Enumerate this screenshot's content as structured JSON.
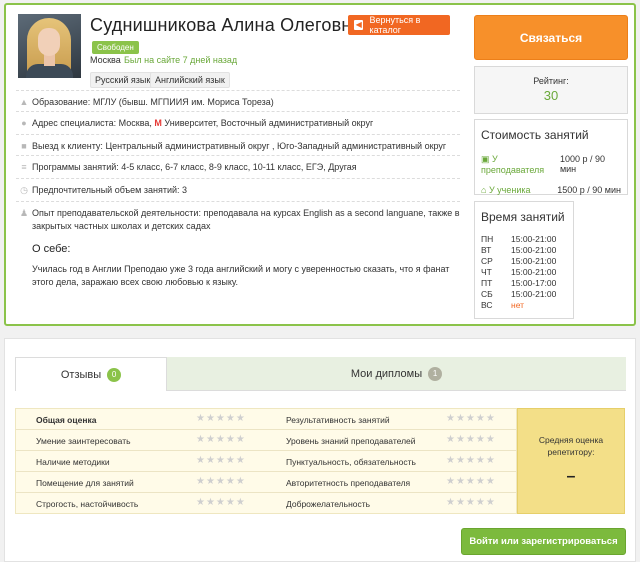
{
  "profile": {
    "name": "Суднишникова Алина Олеговна",
    "back_label": "Вернуться в каталог",
    "status": "Свободен",
    "city": "Москва",
    "last_seen": "Был на сайте 7 дней назад",
    "languages": [
      "Русский язык",
      "Английский язык"
    ],
    "info": [
      {
        "icon": "graduation-cap-icon",
        "label": "Образование:",
        "value": "МГЛУ (бывш. МГПИИЯ им. Мориса Тореза)"
      },
      {
        "icon": "location-icon",
        "label": "Адрес специалиста:",
        "value_before": "Москва,",
        "metro": "M",
        "value_after": "Университет, Восточный административный округ"
      },
      {
        "icon": "car-icon",
        "label": "Выезд к клиенту:",
        "value": "Центральный административный округ , Юго-Западный административный округ"
      },
      {
        "icon": "list-icon",
        "label": "Программы занятий:",
        "value": "4-5 класс, 6-7 класс, 8-9 класс, 10-11 класс, ЕГЭ, Другая"
      },
      {
        "icon": "clock-icon",
        "label": "Предпочтительный объем занятий:",
        "value": "3"
      },
      {
        "icon": "person-icon",
        "label": "Опыт преподавательской деятельности:",
        "value": "преподавала на курсах English as a second languane, также в закрытых частных школах и детских садах"
      }
    ],
    "about_title": "О себе:",
    "about_text": "Училась год в Англии Преподаю уже 3 года английский и могу с уверенностью сказать, что я фанат этого дела, заражаю всех свою любовью к языку."
  },
  "sidebar": {
    "contact_label": "Связаться",
    "rating_label": "Рейтинг:",
    "rating_value": "30",
    "cost_title": "Стоимость занятий",
    "costs": [
      {
        "where": "У преподавателя",
        "price": "1000 р / 90 мин"
      },
      {
        "where": "У ученика",
        "price": "1500 р / 90 мин"
      }
    ],
    "schedule_title": "Время занятий",
    "schedule": [
      {
        "day": "ПН",
        "time": "15:00-21:00"
      },
      {
        "day": "ВТ",
        "time": "15:00-21:00"
      },
      {
        "day": "СР",
        "time": "15:00-21:00"
      },
      {
        "day": "ЧТ",
        "time": "15:00-21:00"
      },
      {
        "day": "ПТ",
        "time": "15:00-17:00"
      },
      {
        "day": "СБ",
        "time": "15:00-21:00"
      },
      {
        "day": "ВС",
        "time": "нет"
      }
    ]
  },
  "reviews": {
    "tabs": [
      {
        "label": "Отзывы",
        "count": "0"
      },
      {
        "label": "Мои дипломы",
        "count": "1"
      }
    ],
    "criteria_left": [
      "Общая оценка",
      "Умение заинтересовать",
      "Наличие методики",
      "Помещение для занятий",
      "Строгость, настойчивость"
    ],
    "criteria_right": [
      "Результативность занятий",
      "Уровень знаний преподавателей",
      "Пунктуальность, обязательность",
      "Авторитетность преподавателя",
      "Доброжелательность"
    ],
    "stars": "★★★★★",
    "avg_label": "Средняя оценка репетитору:",
    "avg_value": "–",
    "login_label": "Войти или зарегистрироваться"
  }
}
